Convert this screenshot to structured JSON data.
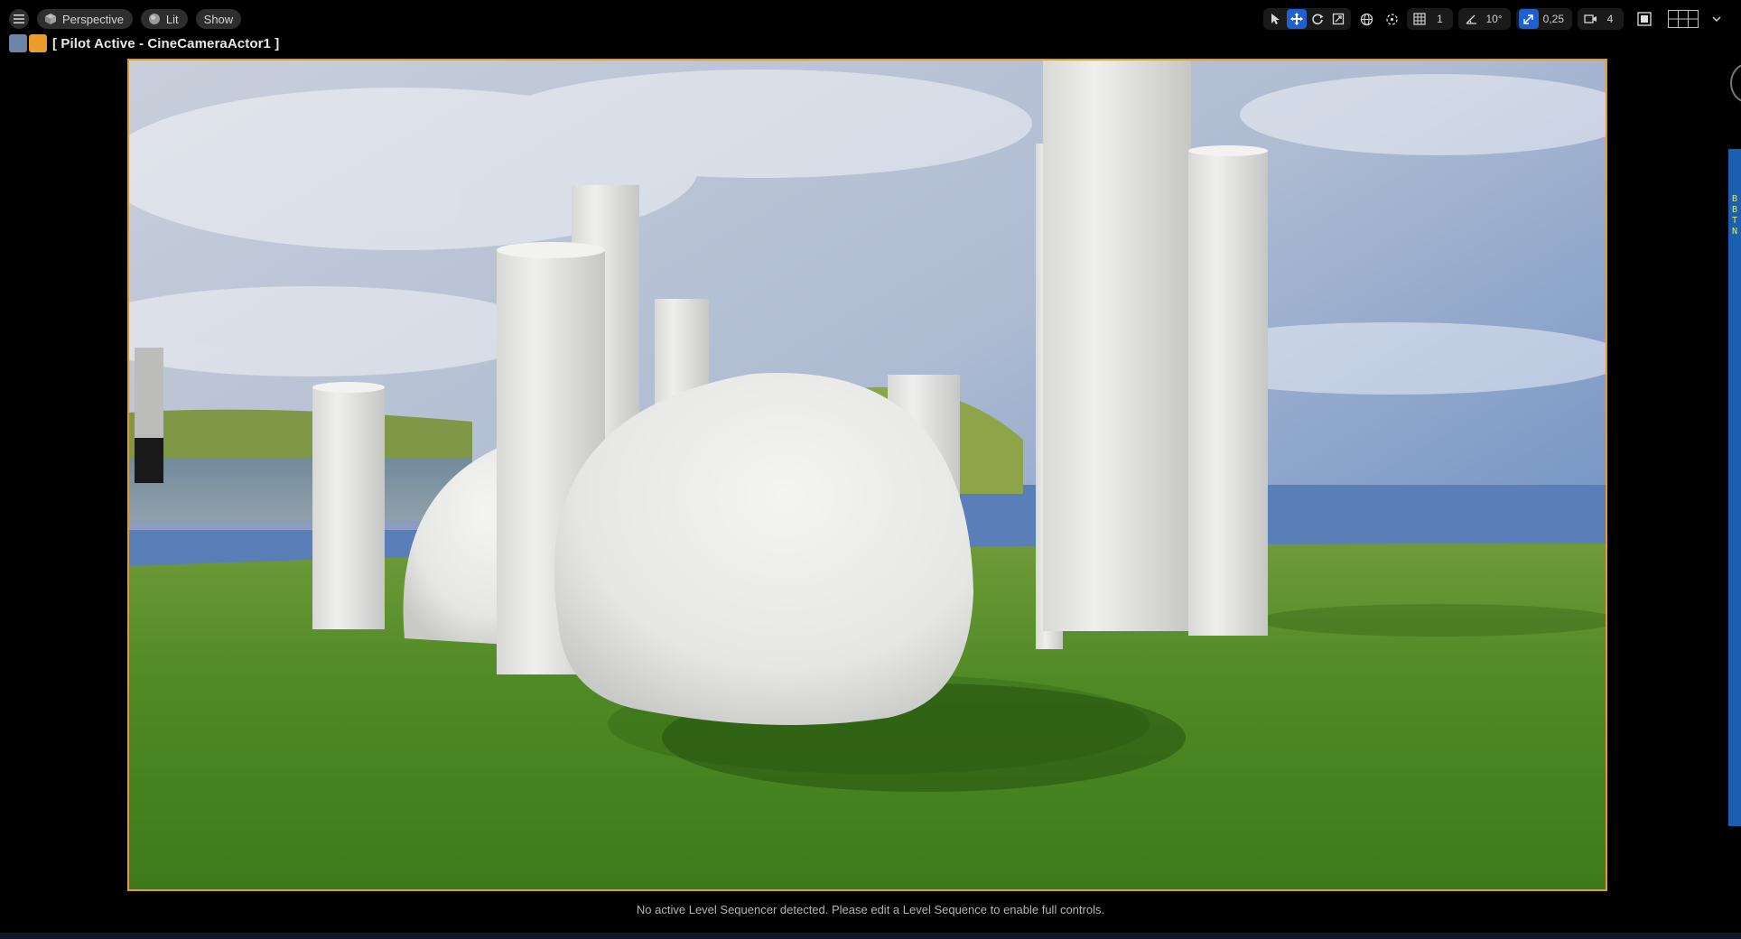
{
  "toolbar": {
    "menu_icon": "hamburger-icon",
    "view_mode": "Perspective",
    "lit_mode": "Lit",
    "show_label": "Show",
    "grid_size": "1",
    "rotation_snap": "10°",
    "scale_snap": "0,25",
    "camera_speed": "4"
  },
  "pilot": {
    "label": "[ Pilot Active - CineCameraActor1 ]"
  },
  "status": {
    "message": "No active Level Sequencer detected. Please edit a Level Sequence to enable full controls."
  },
  "side_panel": {
    "letters": [
      "B",
      "B",
      "T",
      "N"
    ]
  },
  "colors": {
    "accent_blue": "#1f5fcf",
    "viewport_border": "#e59a2f",
    "pilot_icon_orange": "#e89d2d"
  }
}
